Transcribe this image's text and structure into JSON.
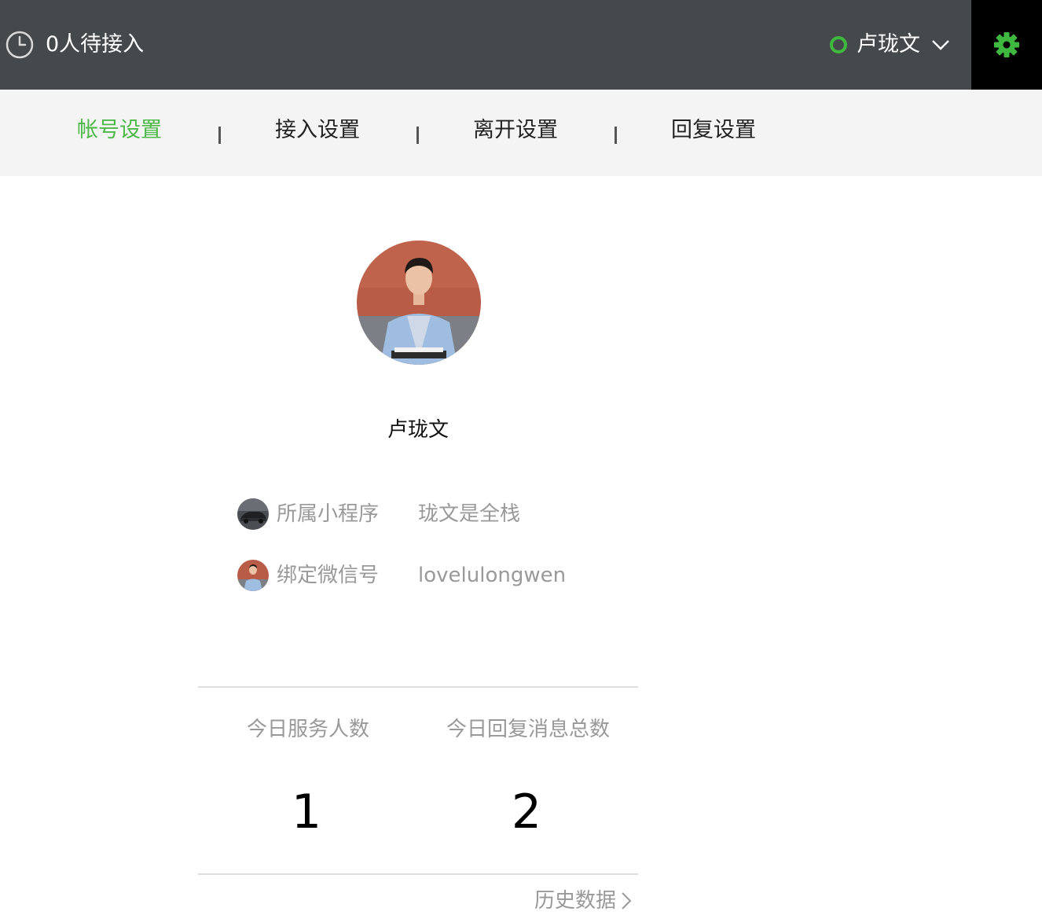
{
  "header": {
    "queue_text": "0人待接入",
    "user_name": "卢珑文",
    "status_color": "#3fb83f",
    "settings_icon": "gear-icon",
    "settings_icon_color": "#3fb83f"
  },
  "tabs": [
    {
      "label": "帐号设置",
      "active": true
    },
    {
      "label": "接入设置",
      "active": false
    },
    {
      "label": "离开设置",
      "active": false
    },
    {
      "label": "回复设置",
      "active": false
    }
  ],
  "profile": {
    "name": "卢珑文",
    "mini_program_label": "所属小程序",
    "mini_program_value": "珑文是全栈",
    "wechat_label": "绑定微信号",
    "wechat_value": "lovelulongwen"
  },
  "stats": {
    "served_label": "今日服务人数",
    "served_value": "1",
    "replies_label": "今日回复消息总数",
    "replies_value": "2"
  },
  "history": {
    "label": "历史数据"
  },
  "colors": {
    "accent": "#4cb848",
    "header_bg": "#45494c",
    "tabbar_bg": "#f4f4f4"
  }
}
